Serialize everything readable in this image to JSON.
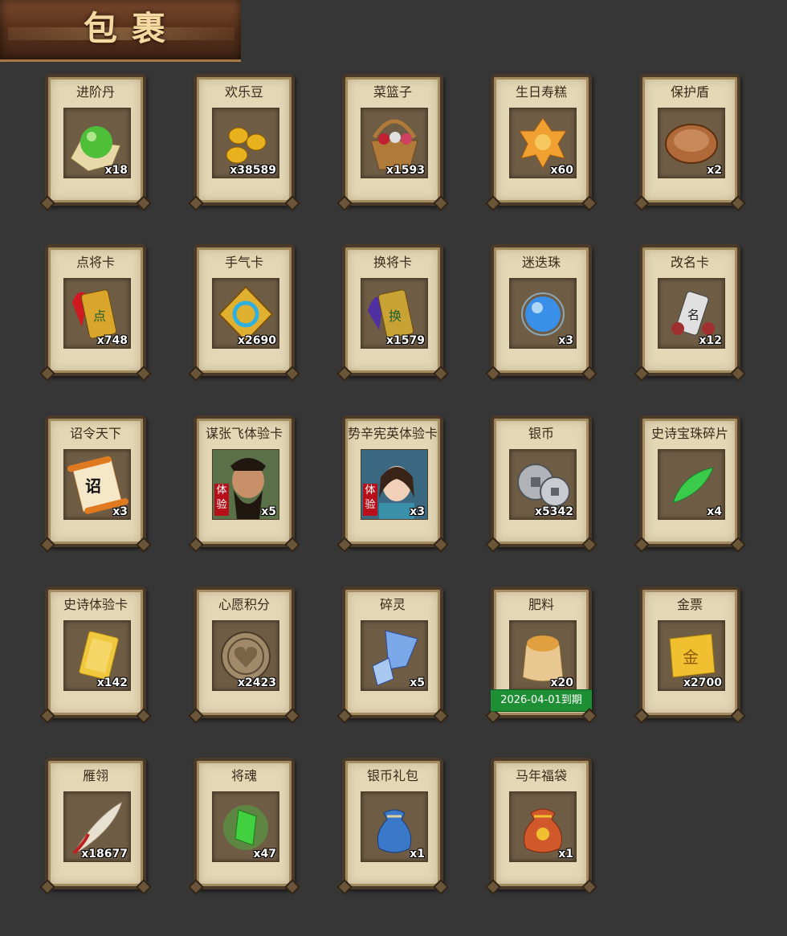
{
  "header": {
    "title": "包裹"
  },
  "items": [
    {
      "name": "进阶丹",
      "count": "x18",
      "icon": "green-orb-icon",
      "color": "#4fbf3a"
    },
    {
      "name": "欢乐豆",
      "count": "x38589",
      "icon": "gold-beans-icon",
      "color": "#e8b21e"
    },
    {
      "name": "菜篮子",
      "count": "x1593",
      "icon": "basket-icon",
      "color": "#b07a3a"
    },
    {
      "name": "生日寿糕",
      "count": "x60",
      "icon": "birthday-cake-icon",
      "color": "#f0a030"
    },
    {
      "name": "保护盾",
      "count": "x2",
      "icon": "round-shield-icon",
      "color": "#b06a3a"
    },
    {
      "name": "点将卡",
      "count": "x748",
      "icon": "general-card-icon",
      "color": "#d9a52a"
    },
    {
      "name": "手气卡",
      "count": "x2690",
      "icon": "luck-card-icon",
      "color": "#e0b030"
    },
    {
      "name": "换将卡",
      "count": "x1579",
      "icon": "swap-general-card-icon",
      "color": "#c9a236"
    },
    {
      "name": "迷迭珠",
      "count": "x3",
      "icon": "blue-orb-icon",
      "color": "#3a8fe8"
    },
    {
      "name": "改名卡",
      "count": "x12",
      "icon": "rename-card-icon",
      "color": "#a03030"
    },
    {
      "name": "诏令天下",
      "count": "x3",
      "icon": "edict-scroll-icon",
      "color": "#e07a20"
    },
    {
      "name": "谋张飞体验卡",
      "count": "x5",
      "icon": "zhang-fei-portrait-icon",
      "color": "#7a5a3a",
      "badge": "体验"
    },
    {
      "name": "势辛宪英体验卡",
      "count": "x3",
      "icon": "xin-xianying-portrait-icon",
      "color": "#d9a890",
      "badge": "体验"
    },
    {
      "name": "银币",
      "count": "x5342",
      "icon": "silver-coins-icon",
      "color": "#b0b4b8"
    },
    {
      "name": "史诗宝珠碎片",
      "count": "x4",
      "icon": "jade-shard-icon",
      "color": "#3acb4a"
    },
    {
      "name": "史诗体验卡",
      "count": "x142",
      "icon": "gold-card-icon",
      "color": "#f0c840"
    },
    {
      "name": "心愿积分",
      "count": "x2423",
      "icon": "heart-coin-icon",
      "color": "#a08a6a"
    },
    {
      "name": "碎灵",
      "count": "x5",
      "icon": "crystal-shard-icon",
      "color": "#7aa8e8"
    },
    {
      "name": "肥料",
      "count": "x20",
      "icon": "fertilizer-bag-icon",
      "color": "#e0a040",
      "expiry": "2026-04-01到期"
    },
    {
      "name": "金票",
      "count": "x2700",
      "icon": "gold-ticket-icon",
      "color": "#f0c030"
    },
    {
      "name": "雁翎",
      "count": "x18677",
      "icon": "feather-icon",
      "color": "#e8e0d0"
    },
    {
      "name": "将魂",
      "count": "x47",
      "icon": "green-soul-crystal-icon",
      "color": "#40d040"
    },
    {
      "name": "银币礼包",
      "count": "x1",
      "icon": "blue-pouch-icon",
      "color": "#3a78c8"
    },
    {
      "name": "马年福袋",
      "count": "x1",
      "icon": "lucky-bag-icon",
      "color": "#d0582a"
    }
  ]
}
